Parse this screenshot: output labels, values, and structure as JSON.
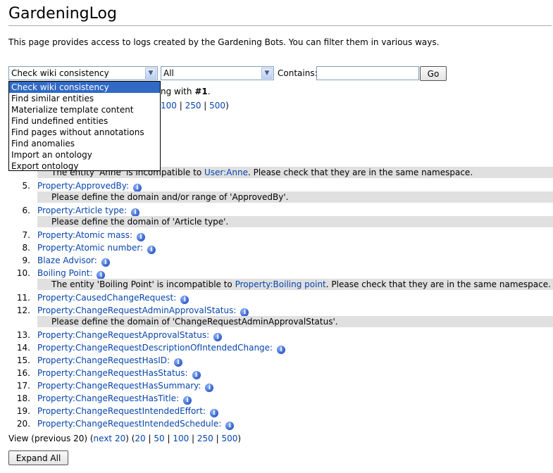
{
  "page": {
    "title": "GardeningLog",
    "intro": "This page provides access to logs created by the Gardening Bots. You can filter them in various ways."
  },
  "filter": {
    "bot_select_value": "Check wiki consistency",
    "type_select_value": "All",
    "contains_label": "Contains:",
    "contains_value": "",
    "go_label": "Go",
    "bot_options": [
      "Check wiki consistency",
      "Find similar entities",
      "Materialize template content",
      "Find undefined entities",
      "Find pages without annotations",
      "Find anomalies",
      "Import an ontology",
      "Export ontology"
    ]
  },
  "behind_dropdown": {
    "line1_prefix": "ng with ",
    "line1_bold": "#1",
    "line1_suffix": ".",
    "line2_prefix": "",
    "line2_100": "100",
    "line2_sep1": " | ",
    "line2_250": "250",
    "line2_sep2": " | ",
    "line2_500": "500",
    "line2_suffix": ")"
  },
  "results": {
    "partial_message_prefix": "The entity 'Anne' is incompatible to ",
    "partial_message_link": "User:Anne",
    "partial_message_suffix": ". Please check that they are in the same namespace.",
    "items": [
      {
        "num": "5.",
        "link": "Property:ApprovedBy:",
        "msg": "Please define the domain and/or range of 'ApprovedBy'."
      },
      {
        "num": "6.",
        "link": "Property:Article type:",
        "msg": "Please define the domain of 'Article type'."
      },
      {
        "num": "7.",
        "link": "Property:Atomic mass:"
      },
      {
        "num": "8.",
        "link": "Property:Atomic number:"
      },
      {
        "num": "9.",
        "link": "Blaze Advisor:"
      },
      {
        "num": "10.",
        "link": "Boiling Point:",
        "msg_prefix": "The entity 'Boiling Point' is incompatible to ",
        "msg_link": "Property:Boiling point",
        "msg_suffix": ". Please check that they are in the same namespace."
      },
      {
        "num": "11.",
        "link": "Property:CausedChangeRequest:"
      },
      {
        "num": "12.",
        "link": "Property:ChangeRequestAdminApprovalStatus:",
        "msg": "Please define the domain of 'ChangeRequestAdminApprovalStatus'."
      },
      {
        "num": "13.",
        "link": "Property:ChangeRequestApprovalStatus:"
      },
      {
        "num": "14.",
        "link": "Property:ChangeRequestDescriptionOfIntendedChange:"
      },
      {
        "num": "15.",
        "link": "Property:ChangeRequestHasID:"
      },
      {
        "num": "16.",
        "link": "Property:ChangeRequestHasStatus:"
      },
      {
        "num": "17.",
        "link": "Property:ChangeRequestHasSummary:"
      },
      {
        "num": "18.",
        "link": "Property:ChangeRequestHasTitle:"
      },
      {
        "num": "19.",
        "link": "Property:ChangeRequestIntendedEffort:"
      },
      {
        "num": "20.",
        "link": "Property:ChangeRequestIntendedSchedule:"
      }
    ]
  },
  "pagination": {
    "view_prefix": "View (previous 20) (",
    "next": "next 20",
    "mid": ") (",
    "n20": "20",
    "n50": "50",
    "n100": "100",
    "n250": "250",
    "n500": "500",
    "sep": " | ",
    "end": ")"
  },
  "expand_all_label": "Expand All",
  "info_icon_glyph": "i"
}
